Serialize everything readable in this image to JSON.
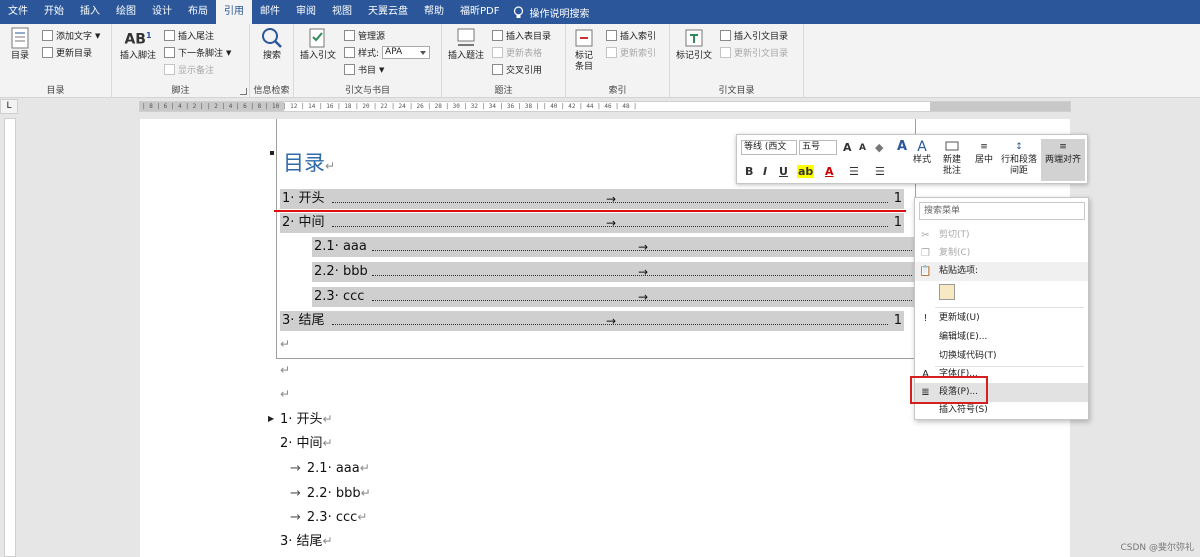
{
  "tabs": [
    "文件",
    "开始",
    "插入",
    "绘图",
    "设计",
    "布局",
    "引用",
    "邮件",
    "审阅",
    "视图",
    "天翼云盘",
    "帮助",
    "福昕PDF"
  ],
  "active_tab": "引用",
  "tell_me": "操作说明搜索",
  "ribbon": {
    "toc": {
      "big": "目录",
      "add_text": "添加文字",
      "update": "更新目录",
      "group": "目录"
    },
    "footnotes": {
      "insert": "插入脚注",
      "insert_endnote": "插入尾注",
      "next": "下一条脚注",
      "show": "显示备注",
      "group": "脚注"
    },
    "research": {
      "search": "搜索",
      "group": "信息检索"
    },
    "citations": {
      "insert": "插入引文",
      "manage": "管理源",
      "style_label": "样式:",
      "style_value": "APA",
      "biblio": "书目",
      "group": "引文与书目"
    },
    "captions": {
      "insert": "插入题注",
      "insert_table": "插入表目录",
      "update_table": "更新表格",
      "cross_ref": "交叉引用",
      "group": "题注"
    },
    "index": {
      "mark": "标记\n条目",
      "insert": "插入索引",
      "update": "更新索引",
      "group": "索引"
    },
    "authorities": {
      "mark": "标记引文",
      "insert": "插入引文目录",
      "update": "更新引文目录",
      "group": "引文目录"
    }
  },
  "ruler_text": "| 8 | 6 | 4 | 2 |  | 2 | 4 | 6 | 8 | 10 | 12 | 14 | 16 | 18 | 20 | 22 | 24 | 26 | 28 | 30 | 32 | 34 | 36 | 38 |  | 40 | 42 | 44 | 46 | 48 |",
  "ruler_corner": "L",
  "document": {
    "toc_title": "目录",
    "return_mark": "↵",
    "tab_arrow": "→",
    "toc_rows": [
      {
        "label": "1· 开头",
        "page": "1"
      },
      {
        "label": "2· 中间",
        "page": "1"
      },
      {
        "label": "2.1· aaa",
        "page": ""
      },
      {
        "label": "2.2· bbb",
        "page": ""
      },
      {
        "label": "2.3· ccc",
        "page": ""
      },
      {
        "label": "3· 结尾",
        "page": "1"
      }
    ],
    "body": [
      "1· 开头",
      "2· 中间",
      "2.1· aaa",
      "2.2· bbb",
      "2.3· ccc",
      "3· 结尾"
    ]
  },
  "mini_toolbar": {
    "font": "等线 (西文",
    "size": "五号",
    "styles": "样式",
    "new_comment": "新建\n批注",
    "center": "居中",
    "line_spacing": "行和段落\n间距",
    "justify": "两端对齐"
  },
  "context_menu": {
    "search": "搜索菜单",
    "items": [
      {
        "label": "剪切(T)",
        "disabled": true
      },
      {
        "label": "复制(C)",
        "disabled": true
      },
      {
        "label": "粘贴选项:",
        "disabled": false
      },
      {
        "label": "更新域(U)",
        "disabled": false
      },
      {
        "label": "编辑域(E)...",
        "disabled": false
      },
      {
        "label": "切换域代码(T)",
        "disabled": false
      },
      {
        "label": "字体(F)...",
        "disabled": false
      },
      {
        "label": "段落(P)...",
        "disabled": false
      },
      {
        "label": "插入符号(S)",
        "disabled": false
      }
    ]
  },
  "watermark": "CSDN @斐尔弥礼",
  "colors": {
    "accent": "#2b579a",
    "heading": "#2f6aa9",
    "highlight_box": "#d42020"
  }
}
